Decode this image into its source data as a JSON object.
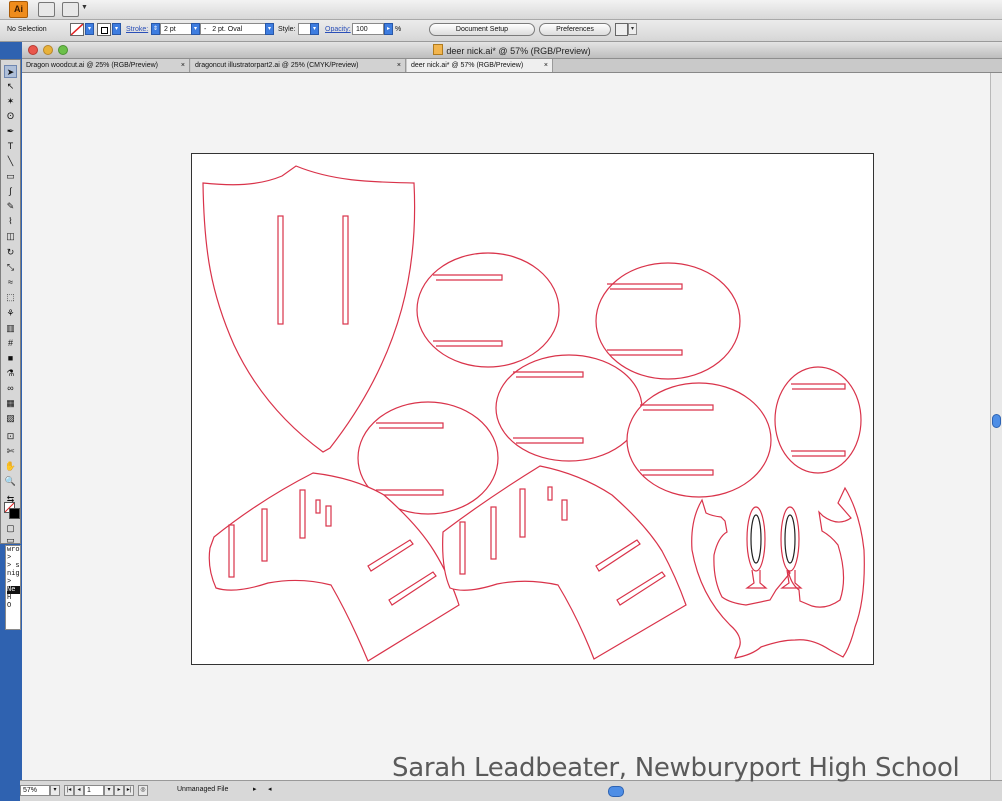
{
  "menubar": {
    "app_icon_text": "Ai"
  },
  "control_bar": {
    "selection_label": "No Selection",
    "stroke_label": "Stroke:",
    "stroke_value": "2 pt",
    "brush_value": "2 pt. Oval",
    "brush_prefix": "-",
    "style_label": "Style:",
    "opacity_label": "Opacity:",
    "opacity_value": "100",
    "percent": "%",
    "document_setup_button": "Document Setup",
    "preferences_button": "Preferences",
    "stroke_color": "#d9334a"
  },
  "window": {
    "title": "deer nick.ai* @ 57% (RGB/Preview)"
  },
  "tabs": [
    {
      "label": "Dragon woodcut.ai @ 25% (RGB/Preview)",
      "close": "×"
    },
    {
      "label": "dragoncut illustratorpart2.ai @ 25% (CMYK/Preview)",
      "close": "×"
    },
    {
      "label": "deer nick.ai* @ 57% (RGB/Preview)",
      "close": "×"
    }
  ],
  "toolbar": {
    "tools": [
      "selection-tool",
      "direct-selection-tool",
      "magic-wand-tool",
      "lasso-tool",
      "pen-tool",
      "type-tool",
      "line-tool",
      "rectangle-tool",
      "paintbrush-tool",
      "pencil-tool",
      "blob-brush-tool",
      "eraser-tool",
      "rotate-tool",
      "scale-tool",
      "warp-tool",
      "free-transform-tool",
      "symbol-sprayer-tool",
      "graph-tool",
      "mesh-tool",
      "gradient-tool",
      "eyedropper-tool",
      "blend-tool",
      "live-paint-tool",
      "live-paint-selection-tool",
      "crop-tool",
      "slice-tool",
      "hand-tool",
      "zoom-tool"
    ],
    "glyphs": [
      "➤",
      "↖",
      "✶",
      "ʘ",
      "✒",
      "T",
      "╲",
      "▭",
      "∫",
      "✎",
      "⌇",
      "◫",
      "↻",
      "⤡",
      "≈",
      "⬚",
      "⚘",
      "▥",
      "#",
      "■",
      "⚗",
      "∞",
      "▦",
      "▨",
      "⊡",
      "✄",
      "✋",
      "🔍"
    ]
  },
  "panel": {
    "lines": [
      "wro",
      ">",
      "> s",
      "nig",
      ">",
      "Ne",
      "H",
      "O"
    ]
  },
  "status_bar": {
    "zoom_value": "57%",
    "page_value": "1",
    "file_status": "Unmanaged File"
  },
  "artwork": {
    "cut_line_color": "#d9334a",
    "fill_color": "#ffffff"
  },
  "watermark": "Sarah Leadbeater, Newburyport High School"
}
